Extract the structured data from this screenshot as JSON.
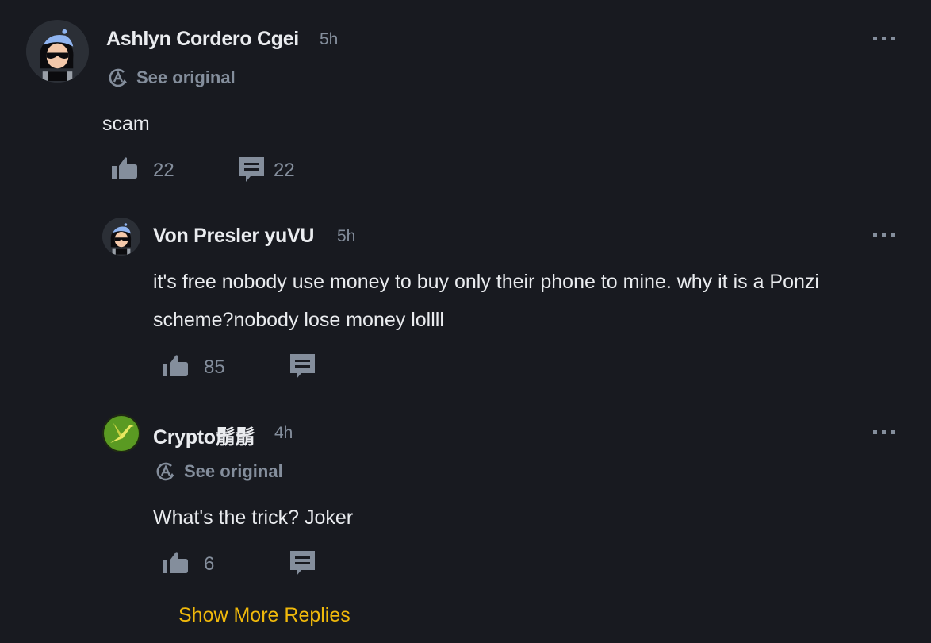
{
  "comments": [
    {
      "author": "Ashlyn Cordero Cgei",
      "time": "5h",
      "see_original": "See original",
      "text": "scam",
      "likes": "22",
      "replies": "22",
      "avatar": "default-avatar-icon"
    },
    {
      "author": "Von Presler yuVU",
      "time": "5h",
      "text": "it's free nobody use money to buy only their phone to mine. why it is a Ponzi scheme?nobody lose money lollll",
      "likes": "85",
      "avatar": "default-avatar-icon"
    },
    {
      "author": "Crypto鬅鬅",
      "time": "4h",
      "see_original": "See original",
      "text": "What's the trick? Joker",
      "likes": "6",
      "avatar": "bird-avatar-icon"
    }
  ],
  "show_more_replies": "Show More Replies",
  "colors": {
    "background": "#181a20",
    "text_primary": "#eaecef",
    "text_secondary": "#848e9c",
    "accent": "#f0b90b"
  }
}
